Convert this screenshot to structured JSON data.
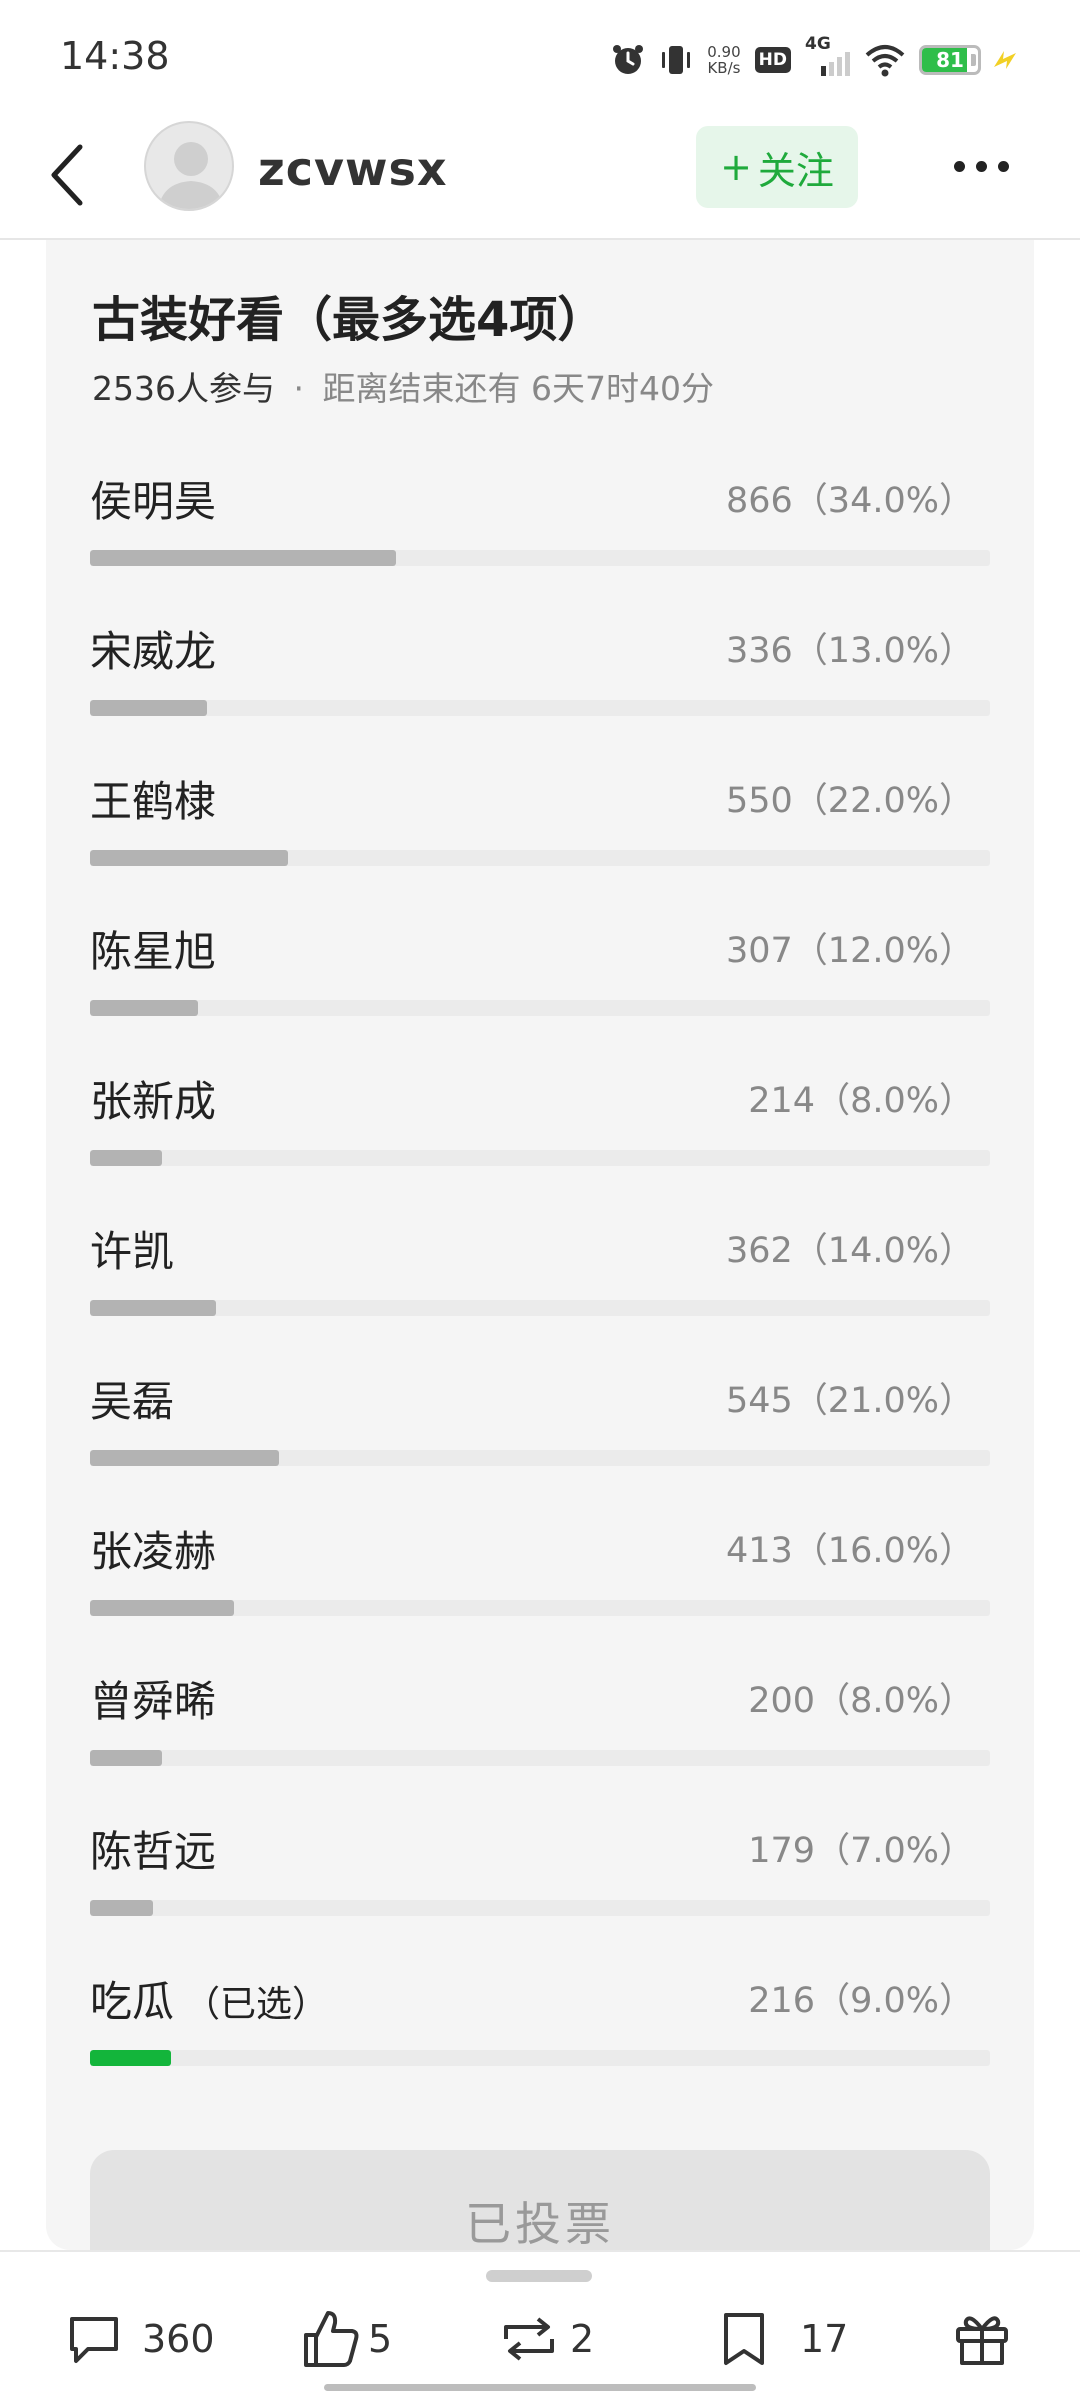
{
  "status_bar": {
    "time": "14:38",
    "net_speed_value": "0.90",
    "net_speed_unit": "KB/s",
    "hd_label": "HD",
    "network_label": "4G",
    "battery_level": "81",
    "icons": [
      "alarm-icon",
      "vibrate-icon",
      "signal-icon",
      "wifi-icon",
      "battery-icon",
      "charging-icon"
    ]
  },
  "header": {
    "username": "zcvwsx",
    "follow_plus": "+",
    "follow_label": "关注",
    "accent_color": "#1faa3c"
  },
  "poll": {
    "title": "古装好看（最多选4项）",
    "participants": "2536人参与",
    "separator": "·",
    "remaining": "距离结束还有 6天7时40分",
    "options": [
      {
        "name": "侯明昊",
        "stats": "866（34.0%）",
        "percent": 34.0,
        "selected": false
      },
      {
        "name": "宋威龙",
        "stats": "336（13.0%）",
        "percent": 13.0,
        "selected": false
      },
      {
        "name": "王鹤棣",
        "stats": "550（22.0%）",
        "percent": 22.0,
        "selected": false
      },
      {
        "name": "陈星旭",
        "stats": "307（12.0%）",
        "percent": 12.0,
        "selected": false
      },
      {
        "name": "张新成",
        "stats": "214（8.0%）",
        "percent": 8.0,
        "selected": false
      },
      {
        "name": "许凯",
        "stats": "362（14.0%）",
        "percent": 14.0,
        "selected": false
      },
      {
        "name": "吴磊",
        "stats": "545（21.0%）",
        "percent": 21.0,
        "selected": false
      },
      {
        "name": "张凌赫",
        "stats": "413（16.0%）",
        "percent": 16.0,
        "selected": false
      },
      {
        "name": "曾舜晞",
        "stats": "200（8.0%）",
        "percent": 8.0,
        "selected": false
      },
      {
        "name": "陈哲远",
        "stats": "179（7.0%）",
        "percent": 7.0,
        "selected": false
      },
      {
        "name": "吃瓜",
        "tag": "（已选）",
        "stats": "216（9.0%）",
        "percent": 9.0,
        "selected": true
      }
    ],
    "voted_label": "已投票",
    "selected_color": "#13b53b"
  },
  "bottom_bar": {
    "comments": "360",
    "likes": "5",
    "reposts": "2",
    "bookmarks": "17"
  }
}
